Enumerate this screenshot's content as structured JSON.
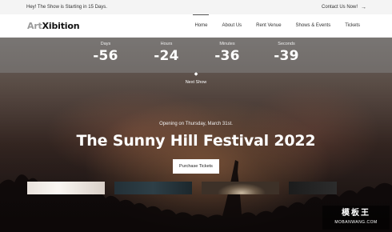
{
  "topbar": {
    "announcement": "Hey! The Show is Starting in 15 Days.",
    "contact_label": "Contact Us Now!",
    "contact_arrow": "→"
  },
  "navbar": {
    "logo_light": "Art",
    "logo_bold": "Xibition",
    "items": [
      {
        "label": "Home",
        "active": true
      },
      {
        "label": "About Us",
        "active": false
      },
      {
        "label": "Rent Venue",
        "active": false
      },
      {
        "label": "Shows & Events",
        "active": false
      },
      {
        "label": "Tickets",
        "active": false
      }
    ]
  },
  "countdown": {
    "units": [
      {
        "label": "Days",
        "value": "-56"
      },
      {
        "label": "Hours",
        "value": "-24"
      },
      {
        "label": "Minutes",
        "value": "-36"
      },
      {
        "label": "Seconds",
        "value": "-39"
      }
    ]
  },
  "next_show": {
    "icon": "◆",
    "label": "Next Show"
  },
  "hero": {
    "opening_text": "Opening on Thursday, March 31st.",
    "title": "The Sunny Hill Festival 2022",
    "purchase_label": "Purchase Tickets"
  },
  "watermark": {
    "top": "模板王",
    "sub": "MOBANWANG.COM"
  },
  "colors": {
    "topbar_bg": "#f4f4f4",
    "navbar_bg": "#ffffff",
    "countdown_overlay": "rgba(130,130,130,0.55)",
    "button_bg": "#ffffff"
  }
}
